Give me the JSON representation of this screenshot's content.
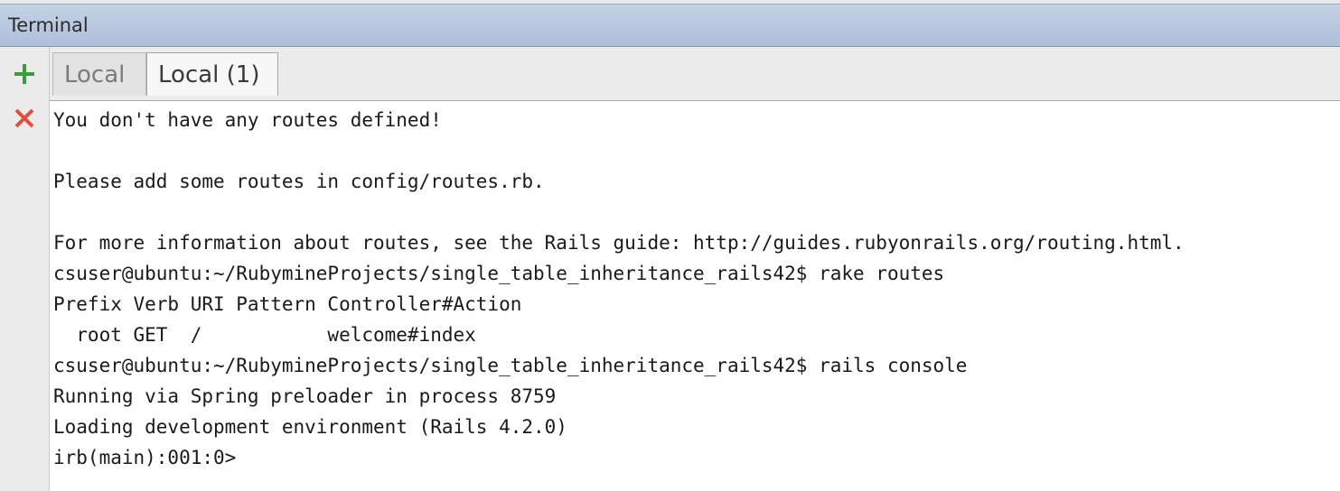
{
  "window": {
    "title": "Terminal"
  },
  "toolbar": {
    "add_icon": "plus-icon",
    "close_icon": "close-icon",
    "add_color": "#3c9c3c",
    "close_color": "#e0503a"
  },
  "tabs": [
    {
      "label": "Local",
      "active": false
    },
    {
      "label": "Local (1)",
      "active": true
    }
  ],
  "terminal": {
    "lines": [
      "You don't have any routes defined!",
      "",
      "Please add some routes in config/routes.rb.",
      "",
      "For more information about routes, see the Rails guide: http://guides.rubyonrails.org/routing.html.",
      "csuser@ubuntu:~/RubymineProjects/single_table_inheritance_rails42$ rake routes",
      "Prefix Verb URI Pattern Controller#Action",
      "  root GET  /           welcome#index",
      "csuser@ubuntu:~/RubymineProjects/single_table_inheritance_rails42$ rails console",
      "Running via Spring preloader in process 8759",
      "Loading development environment (Rails 4.2.0)",
      "irb(main):001:0>"
    ]
  }
}
